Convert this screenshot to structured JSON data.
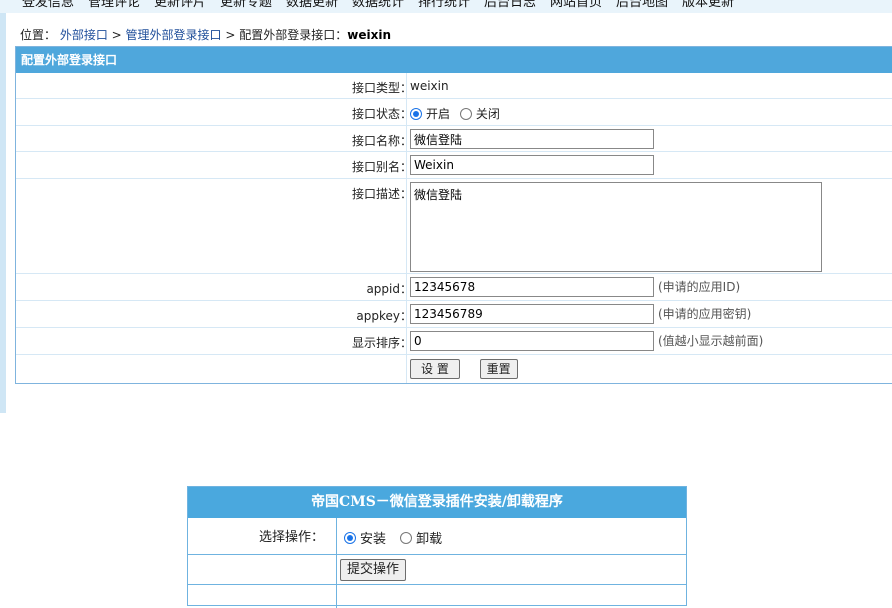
{
  "topnav": [
    "登发信息",
    "管理评论",
    "更新评片",
    "更新专题",
    "数据更新",
    "数据统计",
    "排行统计",
    "后台日志",
    "网站首页",
    "后台地图",
    "版本更新"
  ],
  "breadcrumb": {
    "prefix": "位置：",
    "item1": "外部接口",
    "sep": " > ",
    "item2": "管理外部登录接口",
    "item3": "配置外部登录接口：",
    "current": "weixin"
  },
  "panel": {
    "title": "配置外部登录接口",
    "type_label": "接口类型：",
    "type_value": "weixin",
    "status_label": "接口状态：",
    "status_on": "开启",
    "status_off": "关闭",
    "name_label": "接口名称：",
    "name_value": "微信登陆",
    "alias_label": "接口别名：",
    "alias_value": "Weixin",
    "desc_label": "接口描述：",
    "desc_value": "微信登陆",
    "appid_label": "appid：",
    "appid_value": "12345678",
    "appid_hint": "(申请的应用ID)",
    "appkey_label": "appkey：",
    "appkey_value": "123456789",
    "appkey_hint": "(申请的应用密钥)",
    "order_label": "显示排序：",
    "order_value": "0",
    "order_hint": "(值越小显示越前面)",
    "submit_label": "设 置",
    "reset_label": "重置"
  },
  "installer": {
    "title": "帝国CMS－微信登录插件安装/卸载程序",
    "choose_label": "选择操作：",
    "install": "安装",
    "uninstall": "卸载",
    "submit": "提交操作"
  }
}
